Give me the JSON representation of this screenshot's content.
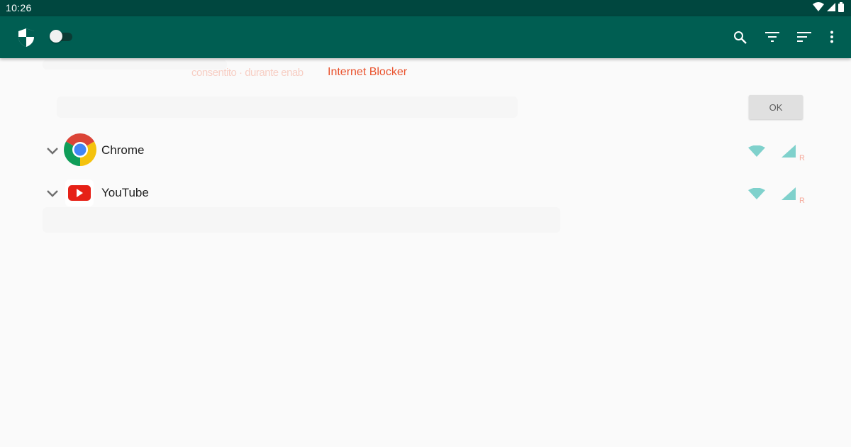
{
  "status_bar": {
    "time": "10:26",
    "icons": [
      "wifi-icon",
      "signal-icon",
      "battery-icon"
    ]
  },
  "toolbar": {
    "background": "#005e52",
    "logo_icon": "shield-icon",
    "master_switch": {
      "state": "off"
    },
    "actions": [
      "search-icon",
      "filter-icon",
      "sort-icon",
      "more-vert-icon"
    ]
  },
  "snackbar": {
    "message": "Internet Blocker",
    "ghost_text": "consentito · durante enab",
    "color": "#e9522d"
  },
  "dialog": {
    "ok_label": "OK"
  },
  "apps": [
    {
      "name": "Chrome",
      "icon": "chrome-icon",
      "wifi_icon": "wifi-icon",
      "mobile_icon": "cell-signal-icon",
      "roaming_label": "R"
    },
    {
      "name": "YouTube",
      "icon": "youtube-icon",
      "wifi_icon": "wifi-icon",
      "mobile_icon": "cell-signal-icon",
      "roaming_label": "R"
    }
  ],
  "colors": {
    "status_bar": "#00473f",
    "toolbar": "#005e52",
    "accent_teal": "#7fd1cc",
    "roaming": "#f5a99a"
  }
}
